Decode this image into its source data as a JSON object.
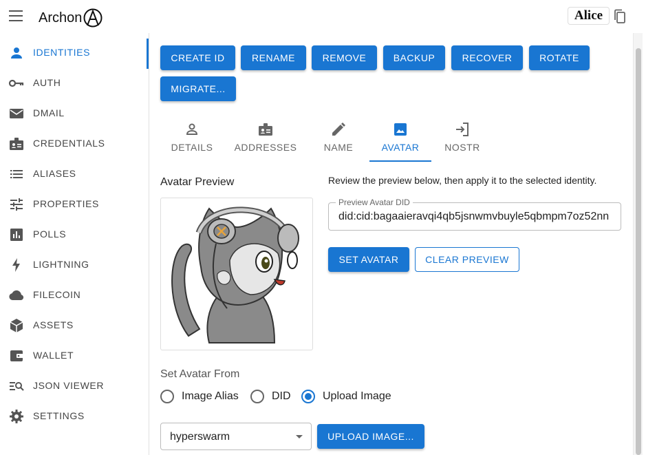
{
  "app": {
    "brand": "Archon",
    "user": "Alice"
  },
  "sidebar": {
    "items": [
      {
        "label": "IDENTITIES",
        "icon": "person-icon",
        "active": true
      },
      {
        "label": "AUTH",
        "icon": "key-icon"
      },
      {
        "label": "DMAIL",
        "icon": "mail-icon"
      },
      {
        "label": "CREDENTIALS",
        "icon": "badge-icon"
      },
      {
        "label": "ALIASES",
        "icon": "list-icon"
      },
      {
        "label": "PROPERTIES",
        "icon": "tune-icon"
      },
      {
        "label": "POLLS",
        "icon": "poll-icon"
      },
      {
        "label": "LIGHTNING",
        "icon": "bolt-icon"
      },
      {
        "label": "FILECOIN",
        "icon": "cloud-icon"
      },
      {
        "label": "ASSETS",
        "icon": "cube-icon"
      },
      {
        "label": "WALLET",
        "icon": "wallet-icon"
      },
      {
        "label": "JSON VIEWER",
        "icon": "search-list-icon"
      },
      {
        "label": "SETTINGS",
        "icon": "gear-icon"
      }
    ]
  },
  "toolbar": {
    "create": "CREATE ID",
    "rename": "RENAME",
    "remove": "REMOVE",
    "backup": "BACKUP",
    "recover": "RECOVER",
    "rotate": "ROTATE",
    "migrate": "MIGRATE..."
  },
  "tabs": [
    {
      "label": "DETAILS",
      "icon": "person-outline-icon"
    },
    {
      "label": "ADDRESSES",
      "icon": "contact-card-icon"
    },
    {
      "label": "NAME",
      "icon": "pencil-icon"
    },
    {
      "label": "AVATAR",
      "icon": "image-icon",
      "active": true
    },
    {
      "label": "NOSTR",
      "icon": "login-icon"
    }
  ],
  "avatar": {
    "preview_title": "Avatar Preview",
    "help_text": "Review the preview below, then apply it to the selected identity.",
    "did_label": "Preview Avatar DID",
    "did_value": "did:cid:bagaaieravqi4qb5jsnwmvbuyle5qbmpm7oz52nn",
    "set_button": "SET AVATAR",
    "clear_button": "CLEAR PREVIEW",
    "source_title": "Set Avatar From",
    "sources": [
      {
        "label": "Image Alias",
        "checked": false
      },
      {
        "label": "DID",
        "checked": false
      },
      {
        "label": "Upload Image",
        "checked": true
      }
    ],
    "registry": "hyperswarm",
    "upload_button": "UPLOAD IMAGE..."
  },
  "colors": {
    "primary": "#1976d2",
    "icon_gray": "#555555"
  }
}
